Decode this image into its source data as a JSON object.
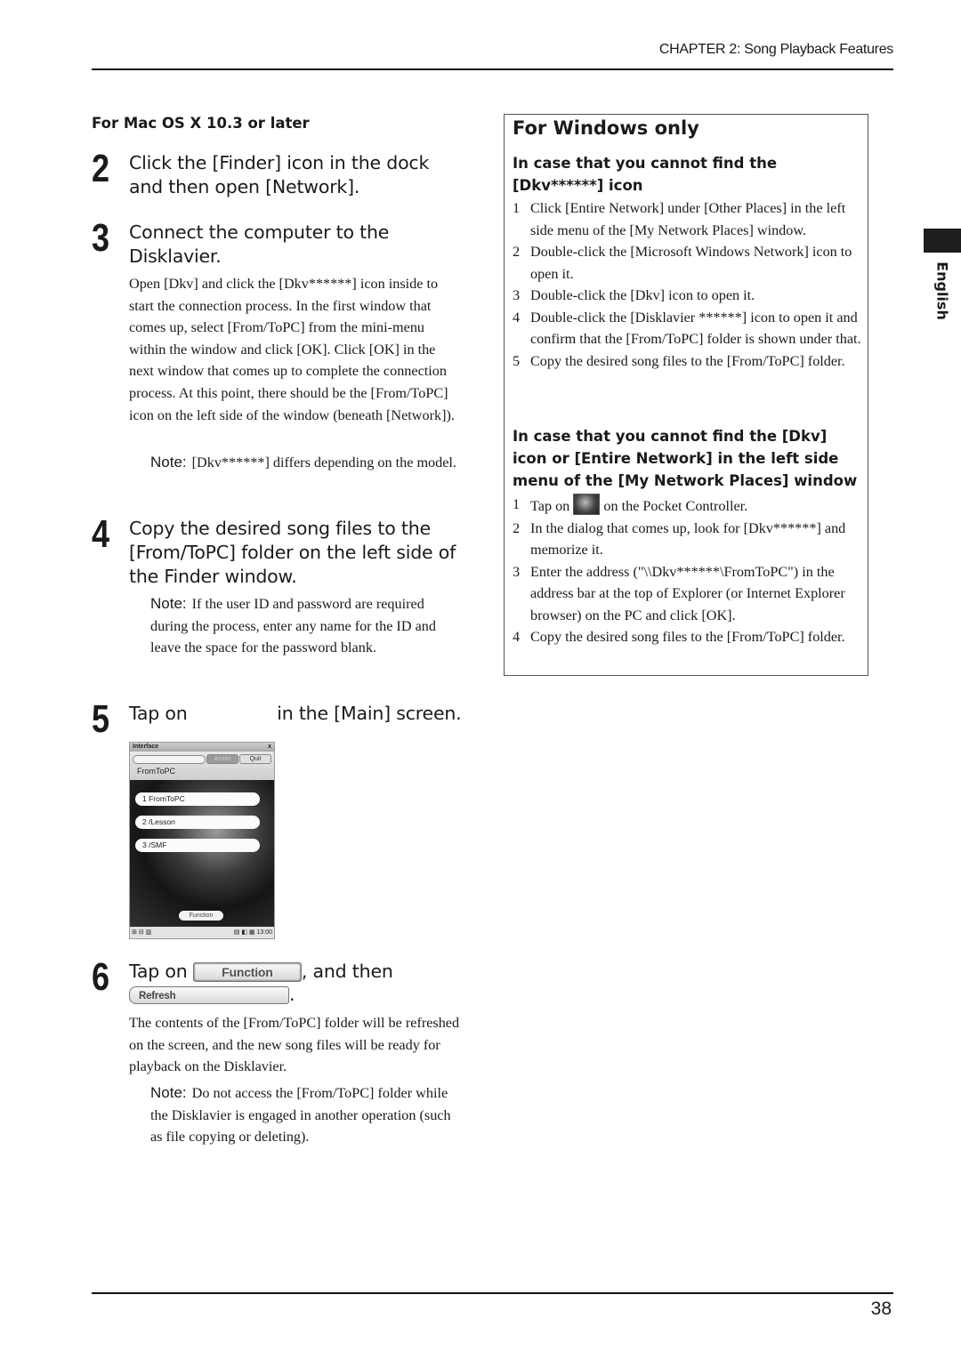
{
  "header": {
    "running_title": "CHAPTER 2: Song Playback Features"
  },
  "side_tab": {
    "language": "English"
  },
  "footer": {
    "page_number": "38"
  },
  "mac_section": {
    "heading": "For Mac OS X 10.3 or later",
    "steps": [
      {
        "number": "2",
        "title": "Click the [Finder] icon in the dock and then open [Network]."
      },
      {
        "number": "3",
        "title": "Connect the computer to the Disklavier.",
        "body": "Open [Dkv] and click the [Dkv******] icon inside to start the connection process. In the first window that comes up, select [From/ToPC] from the mini-menu within the window and click [OK]. Click [OK] in the next window that comes up to complete the connection process. At this point, there should be the [From/ToPC] icon on the left side of the window (beneath [Network]).",
        "note_label": "Note:",
        "note": "[Dkv******] differs depending on the model."
      },
      {
        "number": "4",
        "title": "Copy the desired song files to the [From/ToPC] folder on the left side of the Finder window.",
        "note_label": "Note:",
        "note": "If the user ID and password are required during the process, enter any name for the ID and leave the space for the password blank."
      },
      {
        "number": "5",
        "title_before": "Tap on",
        "title_after": "in the [Main] screen."
      },
      {
        "number": "6",
        "title_before": "Tap on",
        "title_middle": ", and then",
        "title_end": ".",
        "function_button": "Function",
        "refresh_button": "Refresh",
        "body": "The contents of the [From/ToPC] folder will be refreshed on the screen, and the new song files will be ready for playback on the Disklavier.",
        "note_label": "Note:",
        "note": "Do not access the [From/ToPC] folder while the Disklavier is engaged in another operation (such as file copying or deleting)."
      }
    ]
  },
  "pocket_controller": {
    "title": "Interface",
    "close": "x",
    "btn_a": "Assist",
    "btn_b": "Quit",
    "folder": "FromToPC",
    "items": [
      "1  FromToPC",
      "2  /Lesson",
      "3  /SMF"
    ],
    "function_button": "Function",
    "status_left": "⊞ ⊟ ▥",
    "status_right": "▤ ◧ ▦ 13:00"
  },
  "windows_section": {
    "title": "For Windows only",
    "subsections": [
      {
        "heading": "In case that you cannot find the [Dkv******] icon",
        "items": [
          {
            "n": "1",
            "text": "Click [Entire Network] under [Other Places] in the left side menu of the [My Network Places] window."
          },
          {
            "n": "2",
            "text": "Double-click the [Microsoft Windows Network] icon to open it."
          },
          {
            "n": "3",
            "text": "Double-click the [Dkv] icon to open it."
          },
          {
            "n": "4",
            "text": "Double-click the [Disklavier ******] icon to open it and confirm that the [From/ToPC] folder is shown under that."
          },
          {
            "n": "5",
            "text": "Copy the desired song files to the [From/ToPC] folder."
          }
        ]
      },
      {
        "heading": "In case that you cannot find the [Dkv] icon or [Entire Network] in the left side menu of the [My Network Places] window",
        "items": [
          {
            "n": "1",
            "text_before": "Tap on",
            "text_after": "on the Pocket Controller.",
            "icon": "pocket-controller-icon"
          },
          {
            "n": "2",
            "text": "In the dialog that comes up, look for [Dkv******] and memorize it."
          },
          {
            "n": "3",
            "text": "Enter the address (\"\\\\Dkv******\\FromToPC\") in the address bar at the top of Explorer (or Internet Explorer browser) on the PC and click [OK]."
          },
          {
            "n": "4",
            "text": "Copy the desired song files to the [From/ToPC] folder."
          }
        ]
      }
    ]
  }
}
